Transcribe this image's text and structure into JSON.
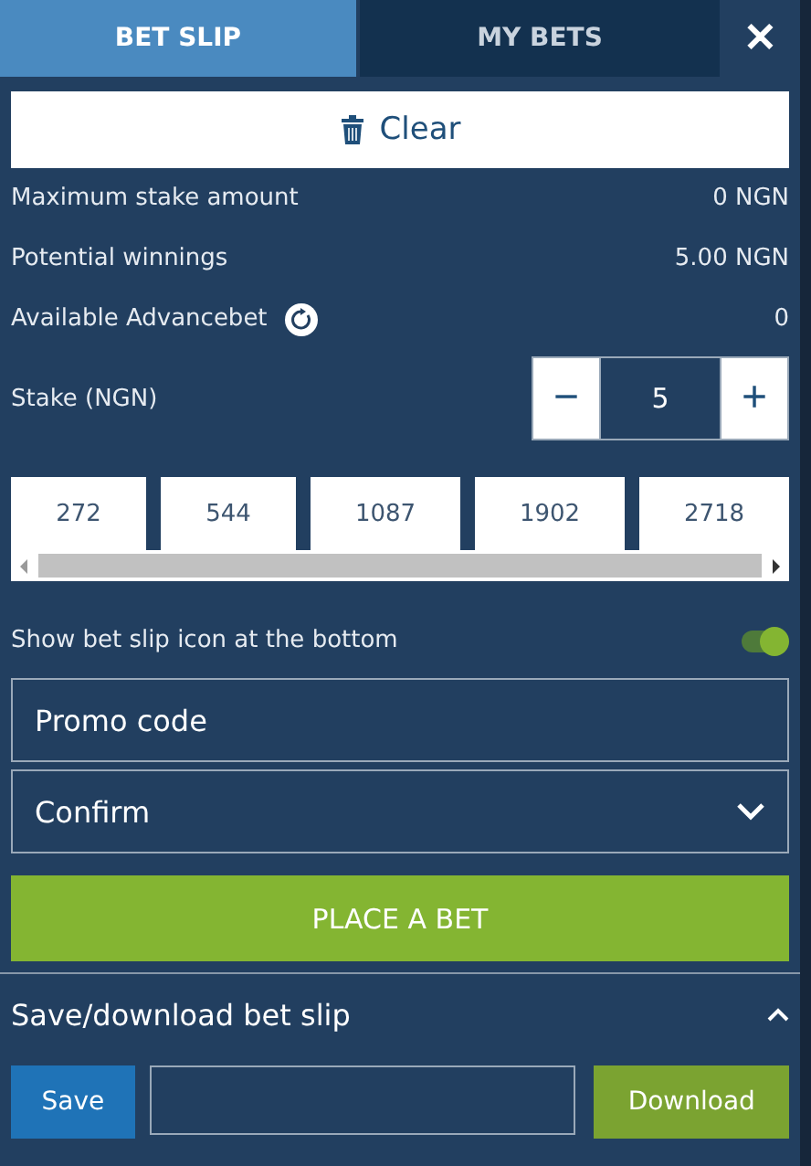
{
  "tabs": [
    {
      "label": "BET SLIP",
      "selected": true
    },
    {
      "label": "MY BETS",
      "selected": false
    }
  ],
  "close": "✕",
  "clear_button": "Clear",
  "summary": [
    {
      "label": "Maximum stake amount",
      "value": "0 NGN",
      "kind": "plain"
    },
    {
      "label": "Potential winnings",
      "value": "5.00 NGN",
      "kind": "plain"
    },
    {
      "label": "Available Advancebet",
      "value": "0",
      "kind": "refresh"
    }
  ],
  "stake": {
    "label": "Stake (NGN)",
    "minus": "−",
    "value": "5",
    "plus": "+"
  },
  "quick_stakes": [
    "272",
    "544",
    "1087",
    "1902",
    "2718"
  ],
  "bottom_icon_toggle": {
    "label": "Show bet slip icon at the bottom",
    "on": true
  },
  "promo_code": {
    "placeholder": "Promo code"
  },
  "confirm_select": {
    "value": "Confirm"
  },
  "place_bet": "PLACE A BET",
  "save_section": {
    "title": "Save/download bet slip",
    "expanded": true,
    "save": "Save",
    "download": "Download"
  }
}
